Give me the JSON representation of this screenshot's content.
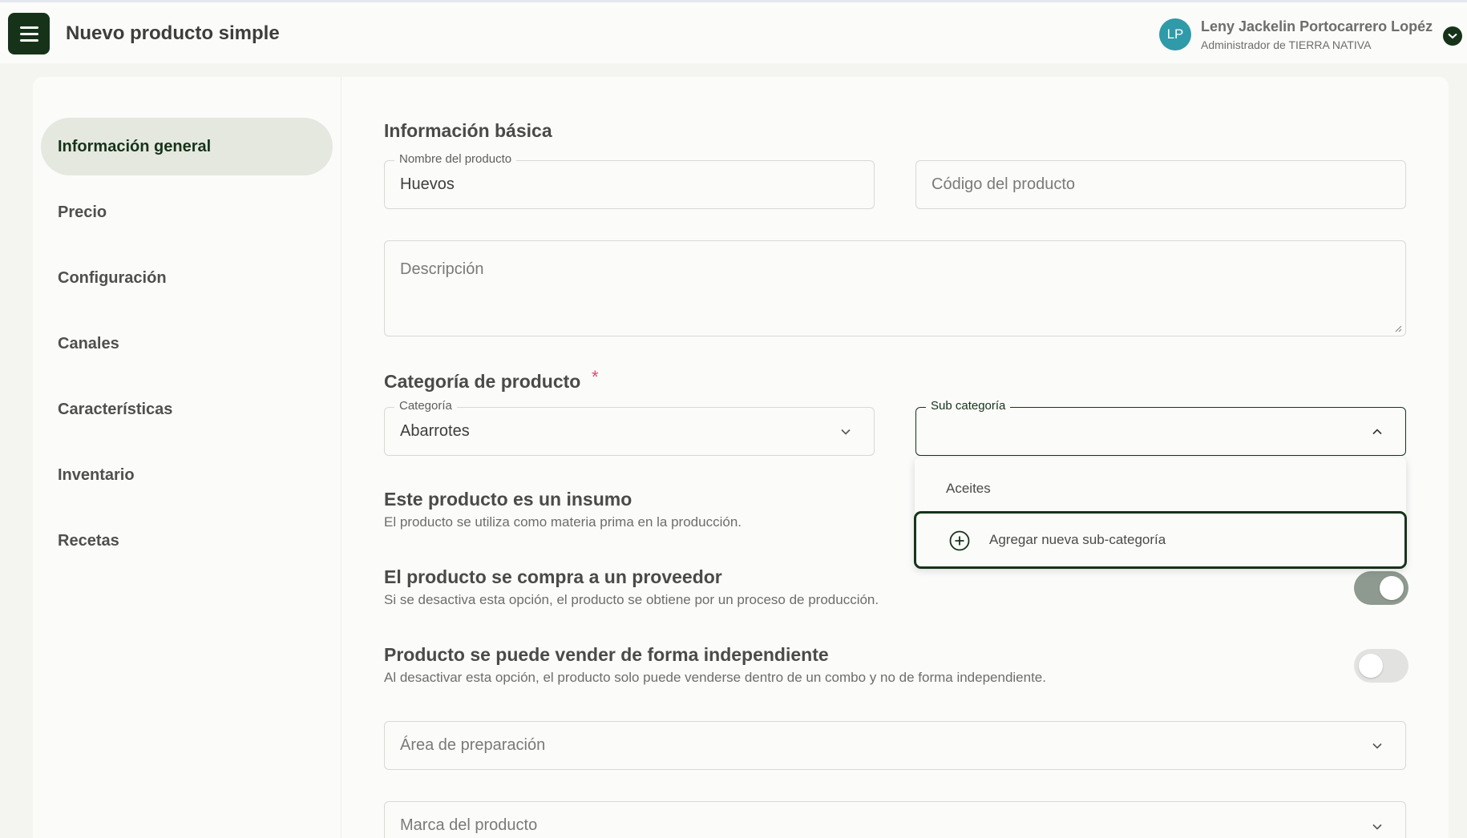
{
  "header": {
    "title": "Nuevo producto simple",
    "avatar_initials": "LP",
    "user_name": "Leny Jackelin Portocarrero Lopéz",
    "user_role": "Administrador de TIERRA NATIVA"
  },
  "sidebar": {
    "items": [
      {
        "label": "Información general",
        "active": true
      },
      {
        "label": "Precio"
      },
      {
        "label": "Configuración"
      },
      {
        "label": "Canales"
      },
      {
        "label": "Características"
      },
      {
        "label": "Inventario"
      },
      {
        "label": "Recetas"
      }
    ]
  },
  "basic_info": {
    "title": "Información básica",
    "name_label": "Nombre del producto",
    "name_value": "Huevos",
    "code_placeholder": "Código del producto",
    "description_placeholder": "Descripción"
  },
  "category": {
    "title": "Categoría de producto",
    "required_mark": "*",
    "category_label": "Categoría",
    "category_value": "Abarrotes",
    "subcategory_label": "Sub categoría",
    "subcategory_value": "",
    "dropdown_options": [
      "Aceites"
    ],
    "add_new_label": "Agregar nueva sub-categoría"
  },
  "settings": [
    {
      "title": "Este producto es un insumo",
      "description": "El producto se utiliza como materia prima en la producción."
    },
    {
      "title": "El producto se compra a un proveedor",
      "description": "Si se desactiva esta opción, el producto se obtiene por un proceso de producción.",
      "enabled": true
    },
    {
      "title": "Producto se puede vender de forma independiente",
      "description": "Al desactivar esta opción, el producto solo puede venderse dentro de un combo y no de forma independiente.",
      "enabled": false
    }
  ],
  "selects": {
    "prep_area_placeholder": "Área de preparación",
    "brand_placeholder": "Marca del producto"
  },
  "colors": {
    "primary": "#16331a",
    "avatar": "#2f9aa8",
    "required": "#e04a6e",
    "nav_active_bg": "#e4e8df"
  }
}
